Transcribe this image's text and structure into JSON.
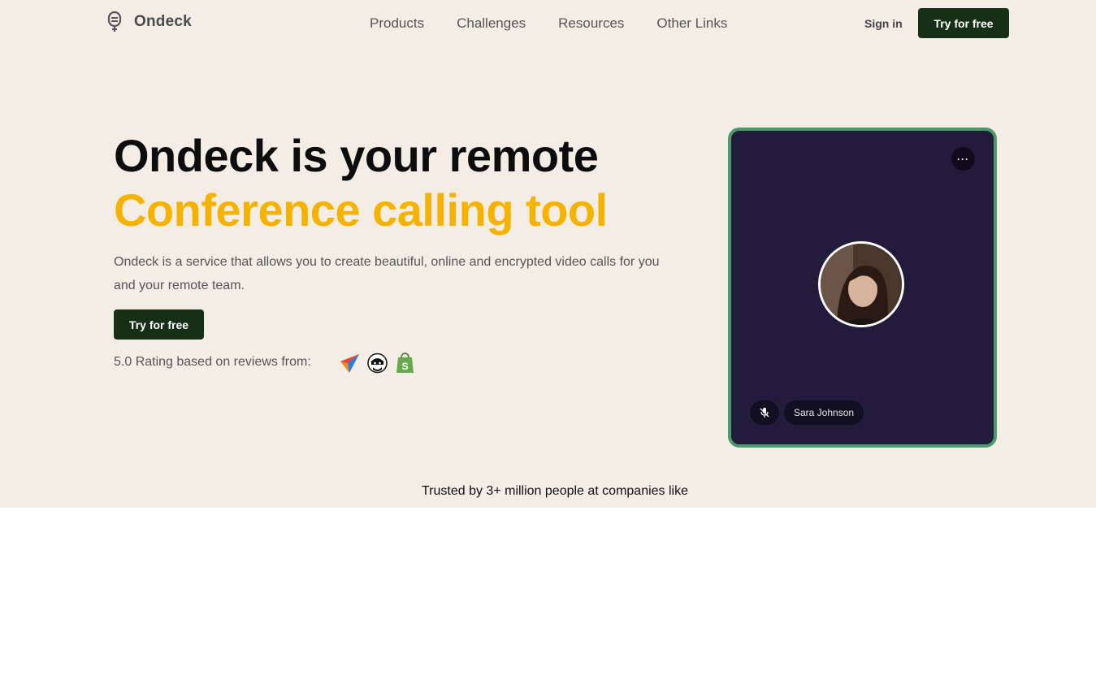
{
  "brand": {
    "name": "Ondeck"
  },
  "nav": {
    "links": [
      "Products",
      "Challenges",
      "Resources",
      "Other Links"
    ],
    "signin": "Sign in",
    "cta": "Try for free"
  },
  "hero": {
    "title_line1": "Ondeck is your remote",
    "title_line2": "Conference calling tool",
    "description": "Ondeck is a service that allows you to create beautiful, online and encrypted video calls for you and your remote team.",
    "cta": "Try for free",
    "rating": "5.0 Rating based on reviews from:",
    "review_icons": [
      "paper-plane-icon",
      "ninja-mascot-icon",
      "shopify-bag-icon"
    ]
  },
  "call_card": {
    "more_label": "···",
    "participant_name": "Sara Johnson",
    "mic_state": "muted"
  },
  "trusted": {
    "text": "Trusted by 3+ million people at companies like"
  },
  "colors": {
    "hero_bg": "#f4ede5",
    "accent_yellow": "#f5b300",
    "dark_green": "#163018",
    "card_bg": "#231b3b",
    "card_border": "#4a9a6a"
  }
}
